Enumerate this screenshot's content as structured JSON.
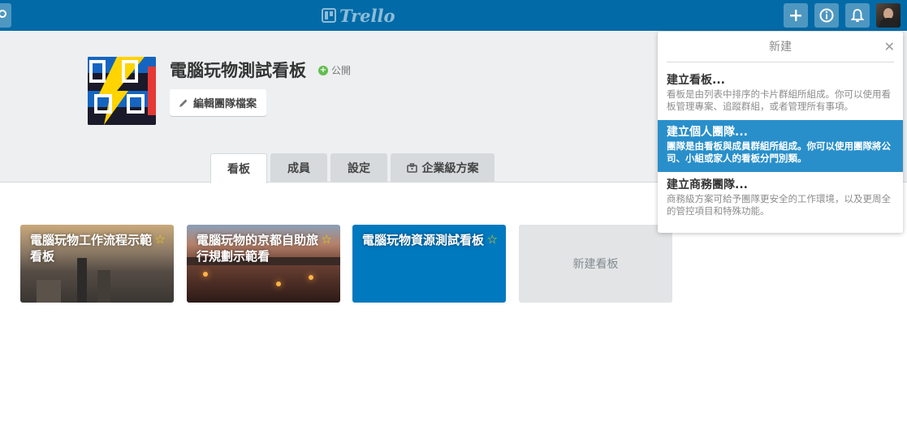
{
  "header": {
    "logo_text": "Trello",
    "add_icon": "plus-icon",
    "info_icon": "info-icon",
    "bell_icon": "bell-icon",
    "avatar": "user-avatar"
  },
  "team": {
    "name": "電腦玩物測試看板",
    "visibility": "公開",
    "edit_label": "編輯團隊檔案"
  },
  "tabs": [
    {
      "label": "看板",
      "active": true
    },
    {
      "label": "成員",
      "active": false
    },
    {
      "label": "設定",
      "active": false
    },
    {
      "label": "企業級方案",
      "active": false
    }
  ],
  "boards": [
    {
      "title": "電腦玩物工作流程示範看板",
      "starred_icon": "star-icon"
    },
    {
      "title": "電腦玩物的京都自助旅行規劃示範看",
      "starred_icon": "star-icon"
    },
    {
      "title": "電腦玩物資源測試看板",
      "starred_icon": "star-icon"
    }
  ],
  "new_board_label": "新建看板",
  "popover": {
    "title": "新建",
    "items": [
      {
        "heading": "建立看板...",
        "desc": "看板是由列表中排序的卡片群組所組成。你可以使用看板管理專案、追蹤群組，或者管理所有事項。",
        "highlighted": false
      },
      {
        "heading": "建立個人團隊...",
        "desc": "團隊是由看板與成員群組所組成。你可以使用團隊將公司、小組或家人的看板分門別類。",
        "highlighted": true
      },
      {
        "heading": "建立商務團隊...",
        "desc": "商務級方案可給予團隊更安全的工作環境，以及更周全的管控項目和特殊功能。",
        "highlighted": false
      }
    ]
  },
  "colors": {
    "header_bg": "#026aa7",
    "board_blue": "#0079bf",
    "highlight": "#298fca",
    "star": "#f2d600",
    "public_green": "#61bd4f"
  }
}
